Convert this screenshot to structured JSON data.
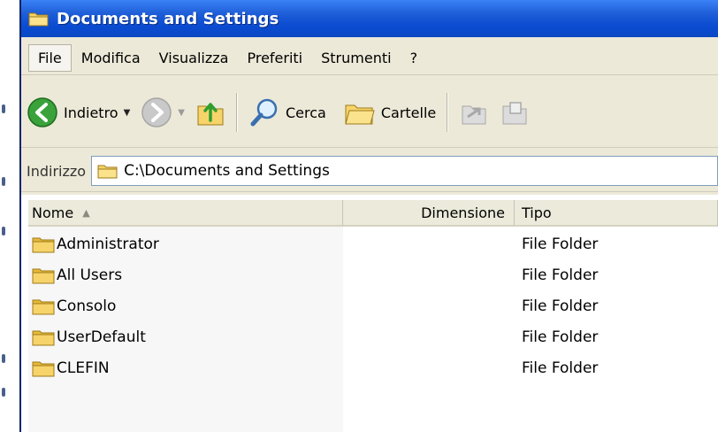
{
  "window": {
    "title": "Documents and Settings"
  },
  "menu": {
    "items": [
      "File",
      "Modifica",
      "Visualizza",
      "Preferiti",
      "Strumenti",
      "?"
    ]
  },
  "toolbar": {
    "back_label": "Indietro",
    "search_label": "Cerca",
    "folders_label": "Cartelle"
  },
  "address": {
    "label": "Indirizzo",
    "value": "C:\\Documents and Settings"
  },
  "columns": {
    "name": "Nome",
    "size": "Dimensione",
    "type": "Tipo"
  },
  "files": [
    {
      "name": "Administrator",
      "size": "",
      "type": "File Folder"
    },
    {
      "name": "All Users",
      "size": "",
      "type": "File Folder"
    },
    {
      "name": "Consolo",
      "size": "",
      "type": "File Folder"
    },
    {
      "name": "UserDefault",
      "size": "",
      "type": "File Folder"
    },
    {
      "name": "CLEFIN",
      "size": "",
      "type": "File Folder"
    }
  ],
  "colors": {
    "titlebar": "#0b49c4",
    "chrome": "#ece9d8",
    "folder": "#f2c84b"
  },
  "icons": [
    "folder-icon",
    "back-icon",
    "forward-icon",
    "up-folder-icon",
    "search-icon",
    "folders-icon",
    "move-to-icon",
    "copy-to-icon"
  ]
}
